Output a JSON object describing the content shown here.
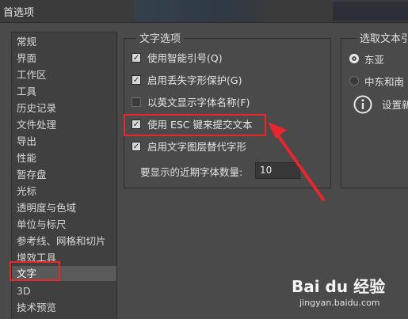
{
  "window": {
    "title": "首选项"
  },
  "sidebar": {
    "items": [
      {
        "label": "常规"
      },
      {
        "label": "界面"
      },
      {
        "label": "工作区"
      },
      {
        "label": "工具"
      },
      {
        "label": "历史记录"
      },
      {
        "label": "文件处理"
      },
      {
        "label": "导出"
      },
      {
        "label": "性能"
      },
      {
        "label": "暂存盘"
      },
      {
        "label": "光标"
      },
      {
        "label": "透明度与色域"
      },
      {
        "label": "单位与标尺"
      },
      {
        "label": "参考线、网格和切片"
      },
      {
        "label": "增效工具"
      },
      {
        "label": "文字",
        "selected": true
      },
      {
        "label": "3D"
      },
      {
        "label": "技术预览"
      }
    ]
  },
  "text_options": {
    "title": "文字选项",
    "options": [
      {
        "label": "使用智能引号(Q)",
        "checked": true
      },
      {
        "label": "启用丢失字形保护(G)",
        "checked": true
      },
      {
        "label": "以英文显示字体名称(F)",
        "checked": false
      },
      {
        "label": "使用 ESC 键来提交文本",
        "checked": true
      },
      {
        "label": "启用文字图层替代字形",
        "checked": true
      }
    ],
    "recent_fonts_label": "要显示的近期字体数量:",
    "recent_fonts_value": "10"
  },
  "text_engine": {
    "title": "选取文本引",
    "options": [
      {
        "label": "东亚",
        "selected": true
      },
      {
        "label": "中东和南",
        "selected": false
      }
    ],
    "info_icon": "info-icon",
    "info_text": "设置新"
  },
  "watermark": {
    "brand": "Bai du 经验",
    "url": "jingyan.baidu.com"
  },
  "colors": {
    "highlight": "#e8262b",
    "panel": "#4a4a4a"
  }
}
